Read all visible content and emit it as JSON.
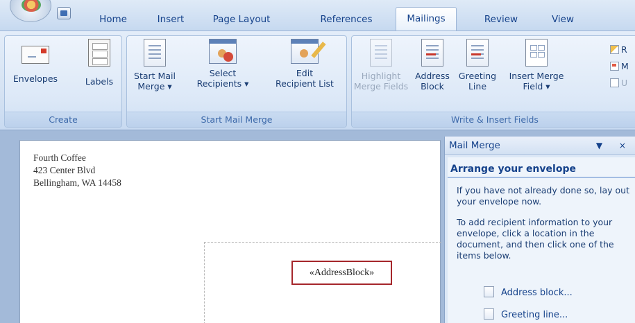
{
  "tabs": [
    {
      "label": "Home"
    },
    {
      "label": "Insert"
    },
    {
      "label": "Page Layout"
    },
    {
      "label": "References"
    },
    {
      "label": "Mailings"
    },
    {
      "label": "Review"
    },
    {
      "label": "View"
    }
  ],
  "ribbon": {
    "create": {
      "group_label": "Create",
      "envelopes": "Envelopes",
      "labels": "Labels"
    },
    "start_mail_merge": {
      "group_label": "Start Mail Merge",
      "start_line1": "Start Mail",
      "start_line2": "Merge ▾",
      "select_line1": "Select",
      "select_line2": "Recipients ▾",
      "edit_line1": "Edit",
      "edit_line2": "Recipient List"
    },
    "write_insert": {
      "group_label": "Write & Insert Fields",
      "highlight_line1": "Highlight",
      "highlight_line2": "Merge Fields",
      "address_line1": "Address",
      "address_line2": "Block",
      "greeting_line1": "Greeting",
      "greeting_line2": "Line",
      "insert_line1": "Insert Merge",
      "insert_line2": "Field ▾",
      "rules": "R",
      "match": "M",
      "update": "U"
    }
  },
  "document": {
    "return_address": [
      "Fourth Coffee",
      "423 Center Blvd",
      "Bellingham, WA 14458"
    ],
    "address_block": "«AddressBlock»"
  },
  "task_pane": {
    "title": "Mail Merge",
    "controls": "▼ ×",
    "section": "Arrange your envelope",
    "para1": "If you have not already done so, lay out your envelope now.",
    "para2": "To add recipient information to your envelope, click a location in the document, and then click one of the items below.",
    "link_address": "Address block...",
    "link_greeting": "Greeting line..."
  },
  "colors": {
    "tab_text": "#15428b",
    "highlight_border": "#a5262b"
  }
}
